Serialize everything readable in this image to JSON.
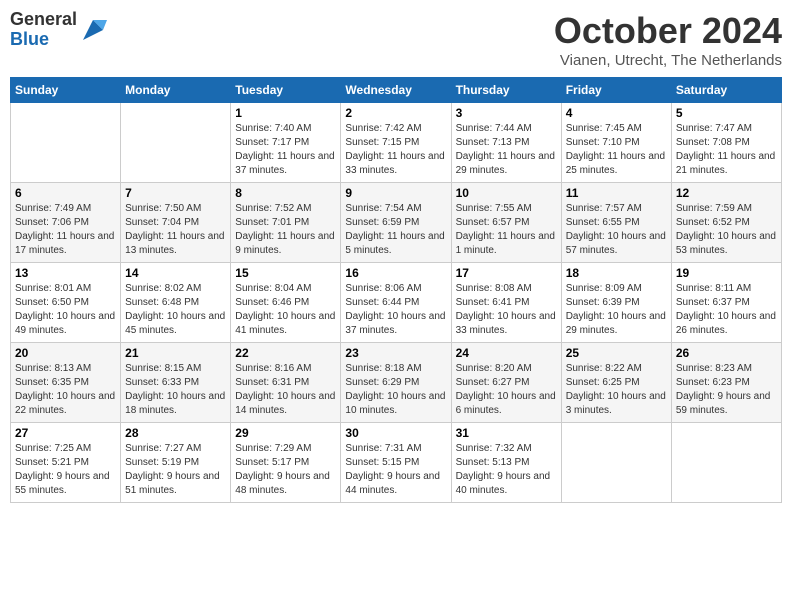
{
  "header": {
    "logo_line1": "General",
    "logo_line2": "Blue",
    "month": "October 2024",
    "location": "Vianen, Utrecht, The Netherlands"
  },
  "weekdays": [
    "Sunday",
    "Monday",
    "Tuesday",
    "Wednesday",
    "Thursday",
    "Friday",
    "Saturday"
  ],
  "weeks": [
    [
      {
        "day": "",
        "sunrise": "",
        "sunset": "",
        "daylight": ""
      },
      {
        "day": "",
        "sunrise": "",
        "sunset": "",
        "daylight": ""
      },
      {
        "day": "1",
        "sunrise": "Sunrise: 7:40 AM",
        "sunset": "Sunset: 7:17 PM",
        "daylight": "Daylight: 11 hours and 37 minutes."
      },
      {
        "day": "2",
        "sunrise": "Sunrise: 7:42 AM",
        "sunset": "Sunset: 7:15 PM",
        "daylight": "Daylight: 11 hours and 33 minutes."
      },
      {
        "day": "3",
        "sunrise": "Sunrise: 7:44 AM",
        "sunset": "Sunset: 7:13 PM",
        "daylight": "Daylight: 11 hours and 29 minutes."
      },
      {
        "day": "4",
        "sunrise": "Sunrise: 7:45 AM",
        "sunset": "Sunset: 7:10 PM",
        "daylight": "Daylight: 11 hours and 25 minutes."
      },
      {
        "day": "5",
        "sunrise": "Sunrise: 7:47 AM",
        "sunset": "Sunset: 7:08 PM",
        "daylight": "Daylight: 11 hours and 21 minutes."
      }
    ],
    [
      {
        "day": "6",
        "sunrise": "Sunrise: 7:49 AM",
        "sunset": "Sunset: 7:06 PM",
        "daylight": "Daylight: 11 hours and 17 minutes."
      },
      {
        "day": "7",
        "sunrise": "Sunrise: 7:50 AM",
        "sunset": "Sunset: 7:04 PM",
        "daylight": "Daylight: 11 hours and 13 minutes."
      },
      {
        "day": "8",
        "sunrise": "Sunrise: 7:52 AM",
        "sunset": "Sunset: 7:01 PM",
        "daylight": "Daylight: 11 hours and 9 minutes."
      },
      {
        "day": "9",
        "sunrise": "Sunrise: 7:54 AM",
        "sunset": "Sunset: 6:59 PM",
        "daylight": "Daylight: 11 hours and 5 minutes."
      },
      {
        "day": "10",
        "sunrise": "Sunrise: 7:55 AM",
        "sunset": "Sunset: 6:57 PM",
        "daylight": "Daylight: 11 hours and 1 minute."
      },
      {
        "day": "11",
        "sunrise": "Sunrise: 7:57 AM",
        "sunset": "Sunset: 6:55 PM",
        "daylight": "Daylight: 10 hours and 57 minutes."
      },
      {
        "day": "12",
        "sunrise": "Sunrise: 7:59 AM",
        "sunset": "Sunset: 6:52 PM",
        "daylight": "Daylight: 10 hours and 53 minutes."
      }
    ],
    [
      {
        "day": "13",
        "sunrise": "Sunrise: 8:01 AM",
        "sunset": "Sunset: 6:50 PM",
        "daylight": "Daylight: 10 hours and 49 minutes."
      },
      {
        "day": "14",
        "sunrise": "Sunrise: 8:02 AM",
        "sunset": "Sunset: 6:48 PM",
        "daylight": "Daylight: 10 hours and 45 minutes."
      },
      {
        "day": "15",
        "sunrise": "Sunrise: 8:04 AM",
        "sunset": "Sunset: 6:46 PM",
        "daylight": "Daylight: 10 hours and 41 minutes."
      },
      {
        "day": "16",
        "sunrise": "Sunrise: 8:06 AM",
        "sunset": "Sunset: 6:44 PM",
        "daylight": "Daylight: 10 hours and 37 minutes."
      },
      {
        "day": "17",
        "sunrise": "Sunrise: 8:08 AM",
        "sunset": "Sunset: 6:41 PM",
        "daylight": "Daylight: 10 hours and 33 minutes."
      },
      {
        "day": "18",
        "sunrise": "Sunrise: 8:09 AM",
        "sunset": "Sunset: 6:39 PM",
        "daylight": "Daylight: 10 hours and 29 minutes."
      },
      {
        "day": "19",
        "sunrise": "Sunrise: 8:11 AM",
        "sunset": "Sunset: 6:37 PM",
        "daylight": "Daylight: 10 hours and 26 minutes."
      }
    ],
    [
      {
        "day": "20",
        "sunrise": "Sunrise: 8:13 AM",
        "sunset": "Sunset: 6:35 PM",
        "daylight": "Daylight: 10 hours and 22 minutes."
      },
      {
        "day": "21",
        "sunrise": "Sunrise: 8:15 AM",
        "sunset": "Sunset: 6:33 PM",
        "daylight": "Daylight: 10 hours and 18 minutes."
      },
      {
        "day": "22",
        "sunrise": "Sunrise: 8:16 AM",
        "sunset": "Sunset: 6:31 PM",
        "daylight": "Daylight: 10 hours and 14 minutes."
      },
      {
        "day": "23",
        "sunrise": "Sunrise: 8:18 AM",
        "sunset": "Sunset: 6:29 PM",
        "daylight": "Daylight: 10 hours and 10 minutes."
      },
      {
        "day": "24",
        "sunrise": "Sunrise: 8:20 AM",
        "sunset": "Sunset: 6:27 PM",
        "daylight": "Daylight: 10 hours and 6 minutes."
      },
      {
        "day": "25",
        "sunrise": "Sunrise: 8:22 AM",
        "sunset": "Sunset: 6:25 PM",
        "daylight": "Daylight: 10 hours and 3 minutes."
      },
      {
        "day": "26",
        "sunrise": "Sunrise: 8:23 AM",
        "sunset": "Sunset: 6:23 PM",
        "daylight": "Daylight: 9 hours and 59 minutes."
      }
    ],
    [
      {
        "day": "27",
        "sunrise": "Sunrise: 7:25 AM",
        "sunset": "Sunset: 5:21 PM",
        "daylight": "Daylight: 9 hours and 55 minutes."
      },
      {
        "day": "28",
        "sunrise": "Sunrise: 7:27 AM",
        "sunset": "Sunset: 5:19 PM",
        "daylight": "Daylight: 9 hours and 51 minutes."
      },
      {
        "day": "29",
        "sunrise": "Sunrise: 7:29 AM",
        "sunset": "Sunset: 5:17 PM",
        "daylight": "Daylight: 9 hours and 48 minutes."
      },
      {
        "day": "30",
        "sunrise": "Sunrise: 7:31 AM",
        "sunset": "Sunset: 5:15 PM",
        "daylight": "Daylight: 9 hours and 44 minutes."
      },
      {
        "day": "31",
        "sunrise": "Sunrise: 7:32 AM",
        "sunset": "Sunset: 5:13 PM",
        "daylight": "Daylight: 9 hours and 40 minutes."
      },
      {
        "day": "",
        "sunrise": "",
        "sunset": "",
        "daylight": ""
      },
      {
        "day": "",
        "sunrise": "",
        "sunset": "",
        "daylight": ""
      }
    ]
  ]
}
